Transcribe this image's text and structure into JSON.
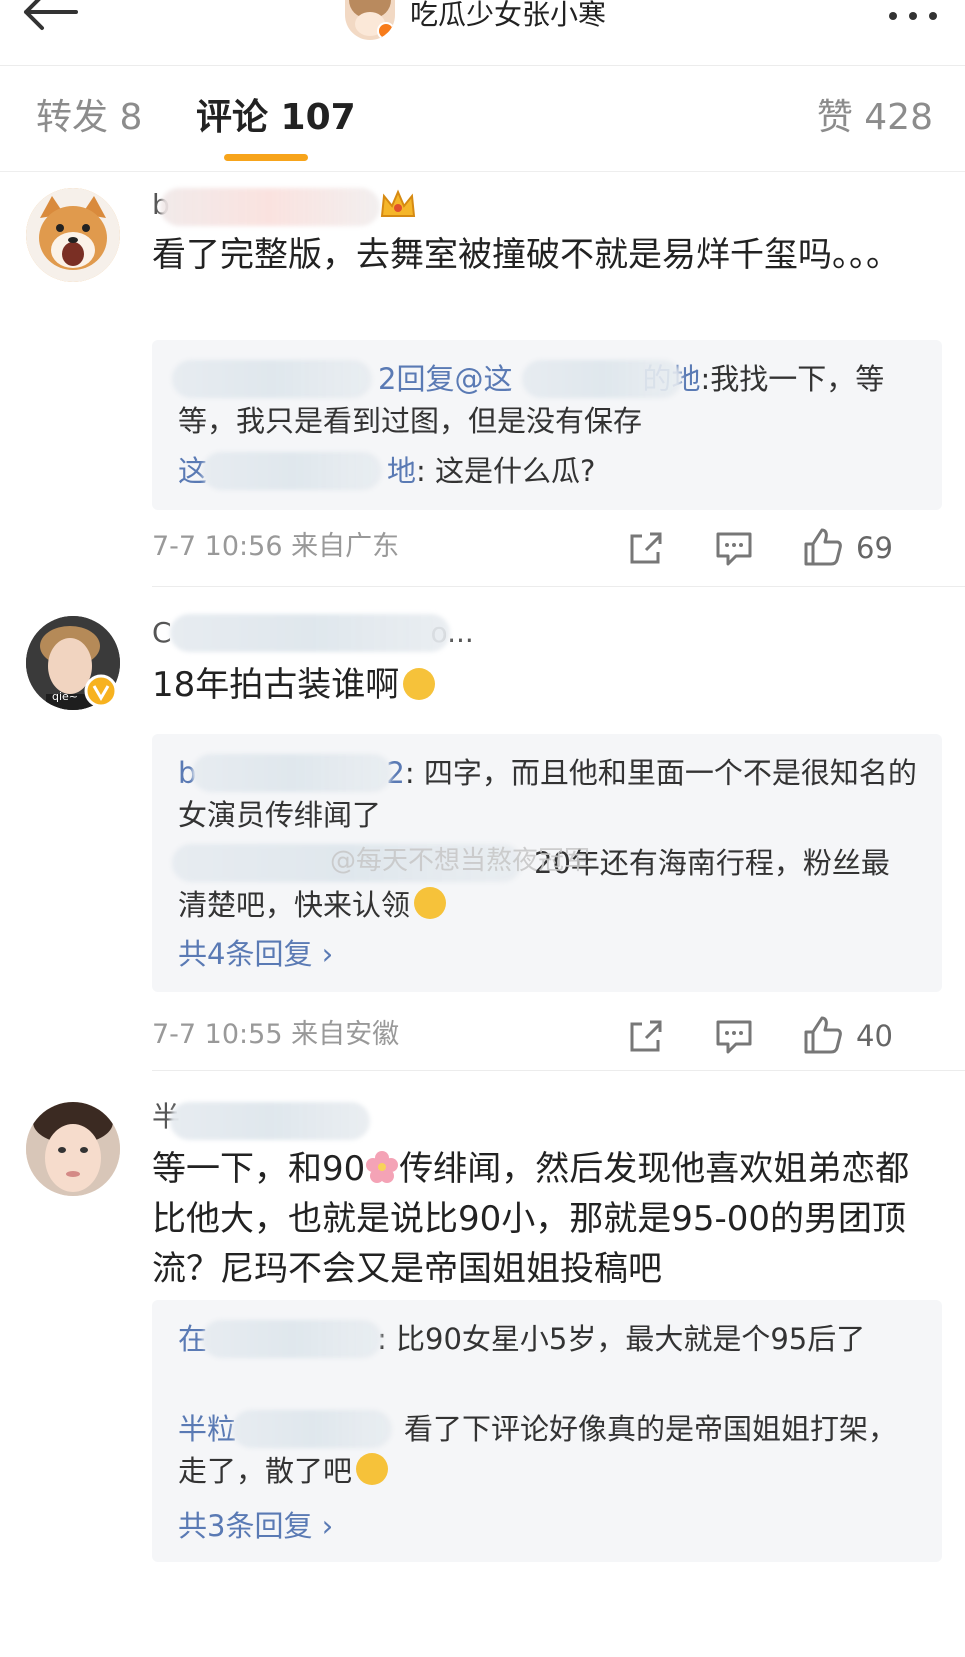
{
  "header": {
    "title": "吃瓜少女张小寒",
    "back_icon": "back-arrow-icon",
    "more_icon": "more-dots-icon"
  },
  "tabs": {
    "repost": "转发 8",
    "comments": "评论 107",
    "likes": "赞 428"
  },
  "comments": [
    {
      "username_prefix": "b",
      "content": "看了完整版，去舞室被撞破不就是易烊千玺吗。。。",
      "replies": [
        {
          "name": "2回复@这",
          "name_suffix": "的地",
          "text": ":我找一下，等等，我只是看到过图，但是没有保存"
        },
        {
          "name": "这",
          "name_suffix": "地",
          "text": ": 这是什么瓜?"
        }
      ],
      "time": "7-7 10:56 来自广东",
      "likes": "69"
    },
    {
      "username_prefix": "C",
      "username_suffix": "o...",
      "content": "18年拍古装谁啊",
      "replies": [
        {
          "name": "b",
          "name_suffix": "2",
          "text": ": 四字，而且他和里面一个不是很知名的女演员传绯闻了"
        },
        {
          "name": "",
          "name_suffix": "",
          "text": "20年还有海南行程，粉丝最清楚吧，快来认领"
        }
      ],
      "more_replies": "共4条回复 ›",
      "time": "7-7 10:55 来自安徽",
      "likes": "40"
    },
    {
      "username_prefix": "半",
      "content_a": "等一下，和90",
      "content_b": "传绯闻，然后发现他喜欢姐弟恋都比他大，也就是说比90小，那就是95-00的男团顶流？尼玛不会又是帝国姐姐投稿吧",
      "replies": [
        {
          "name": "在",
          "name_suffix": "",
          "text": ": 比90女星小5岁，最大就是个95后了"
        },
        {
          "name": "半粒",
          "name_suffix": "",
          "text": "看了下评论好像真的是帝国姐姐打架，走了，散了吧"
        }
      ],
      "more_replies": "共3条回复 ›"
    }
  ],
  "watermark": "@每天不想当熬夜冠军"
}
